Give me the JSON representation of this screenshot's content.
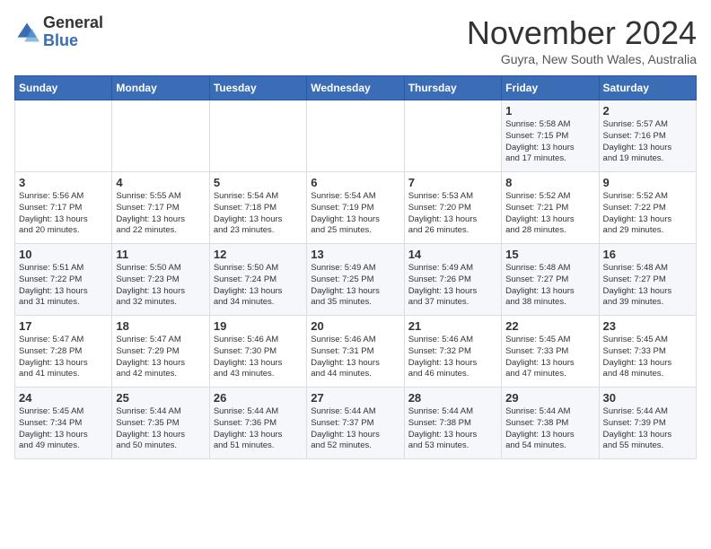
{
  "logo": {
    "general": "General",
    "blue": "Blue"
  },
  "title": "November 2024",
  "location": "Guyra, New South Wales, Australia",
  "weekdays": [
    "Sunday",
    "Monday",
    "Tuesday",
    "Wednesday",
    "Thursday",
    "Friday",
    "Saturday"
  ],
  "weeks": [
    [
      {
        "day": "",
        "info": ""
      },
      {
        "day": "",
        "info": ""
      },
      {
        "day": "",
        "info": ""
      },
      {
        "day": "",
        "info": ""
      },
      {
        "day": "",
        "info": ""
      },
      {
        "day": "1",
        "info": "Sunrise: 5:58 AM\nSunset: 7:15 PM\nDaylight: 13 hours\nand 17 minutes."
      },
      {
        "day": "2",
        "info": "Sunrise: 5:57 AM\nSunset: 7:16 PM\nDaylight: 13 hours\nand 19 minutes."
      }
    ],
    [
      {
        "day": "3",
        "info": "Sunrise: 5:56 AM\nSunset: 7:17 PM\nDaylight: 13 hours\nand 20 minutes."
      },
      {
        "day": "4",
        "info": "Sunrise: 5:55 AM\nSunset: 7:17 PM\nDaylight: 13 hours\nand 22 minutes."
      },
      {
        "day": "5",
        "info": "Sunrise: 5:54 AM\nSunset: 7:18 PM\nDaylight: 13 hours\nand 23 minutes."
      },
      {
        "day": "6",
        "info": "Sunrise: 5:54 AM\nSunset: 7:19 PM\nDaylight: 13 hours\nand 25 minutes."
      },
      {
        "day": "7",
        "info": "Sunrise: 5:53 AM\nSunset: 7:20 PM\nDaylight: 13 hours\nand 26 minutes."
      },
      {
        "day": "8",
        "info": "Sunrise: 5:52 AM\nSunset: 7:21 PM\nDaylight: 13 hours\nand 28 minutes."
      },
      {
        "day": "9",
        "info": "Sunrise: 5:52 AM\nSunset: 7:22 PM\nDaylight: 13 hours\nand 29 minutes."
      }
    ],
    [
      {
        "day": "10",
        "info": "Sunrise: 5:51 AM\nSunset: 7:22 PM\nDaylight: 13 hours\nand 31 minutes."
      },
      {
        "day": "11",
        "info": "Sunrise: 5:50 AM\nSunset: 7:23 PM\nDaylight: 13 hours\nand 32 minutes."
      },
      {
        "day": "12",
        "info": "Sunrise: 5:50 AM\nSunset: 7:24 PM\nDaylight: 13 hours\nand 34 minutes."
      },
      {
        "day": "13",
        "info": "Sunrise: 5:49 AM\nSunset: 7:25 PM\nDaylight: 13 hours\nand 35 minutes."
      },
      {
        "day": "14",
        "info": "Sunrise: 5:49 AM\nSunset: 7:26 PM\nDaylight: 13 hours\nand 37 minutes."
      },
      {
        "day": "15",
        "info": "Sunrise: 5:48 AM\nSunset: 7:27 PM\nDaylight: 13 hours\nand 38 minutes."
      },
      {
        "day": "16",
        "info": "Sunrise: 5:48 AM\nSunset: 7:27 PM\nDaylight: 13 hours\nand 39 minutes."
      }
    ],
    [
      {
        "day": "17",
        "info": "Sunrise: 5:47 AM\nSunset: 7:28 PM\nDaylight: 13 hours\nand 41 minutes."
      },
      {
        "day": "18",
        "info": "Sunrise: 5:47 AM\nSunset: 7:29 PM\nDaylight: 13 hours\nand 42 minutes."
      },
      {
        "day": "19",
        "info": "Sunrise: 5:46 AM\nSunset: 7:30 PM\nDaylight: 13 hours\nand 43 minutes."
      },
      {
        "day": "20",
        "info": "Sunrise: 5:46 AM\nSunset: 7:31 PM\nDaylight: 13 hours\nand 44 minutes."
      },
      {
        "day": "21",
        "info": "Sunrise: 5:46 AM\nSunset: 7:32 PM\nDaylight: 13 hours\nand 46 minutes."
      },
      {
        "day": "22",
        "info": "Sunrise: 5:45 AM\nSunset: 7:33 PM\nDaylight: 13 hours\nand 47 minutes."
      },
      {
        "day": "23",
        "info": "Sunrise: 5:45 AM\nSunset: 7:33 PM\nDaylight: 13 hours\nand 48 minutes."
      }
    ],
    [
      {
        "day": "24",
        "info": "Sunrise: 5:45 AM\nSunset: 7:34 PM\nDaylight: 13 hours\nand 49 minutes."
      },
      {
        "day": "25",
        "info": "Sunrise: 5:44 AM\nSunset: 7:35 PM\nDaylight: 13 hours\nand 50 minutes."
      },
      {
        "day": "26",
        "info": "Sunrise: 5:44 AM\nSunset: 7:36 PM\nDaylight: 13 hours\nand 51 minutes."
      },
      {
        "day": "27",
        "info": "Sunrise: 5:44 AM\nSunset: 7:37 PM\nDaylight: 13 hours\nand 52 minutes."
      },
      {
        "day": "28",
        "info": "Sunrise: 5:44 AM\nSunset: 7:38 PM\nDaylight: 13 hours\nand 53 minutes."
      },
      {
        "day": "29",
        "info": "Sunrise: 5:44 AM\nSunset: 7:38 PM\nDaylight: 13 hours\nand 54 minutes."
      },
      {
        "day": "30",
        "info": "Sunrise: 5:44 AM\nSunset: 7:39 PM\nDaylight: 13 hours\nand 55 minutes."
      }
    ]
  ]
}
